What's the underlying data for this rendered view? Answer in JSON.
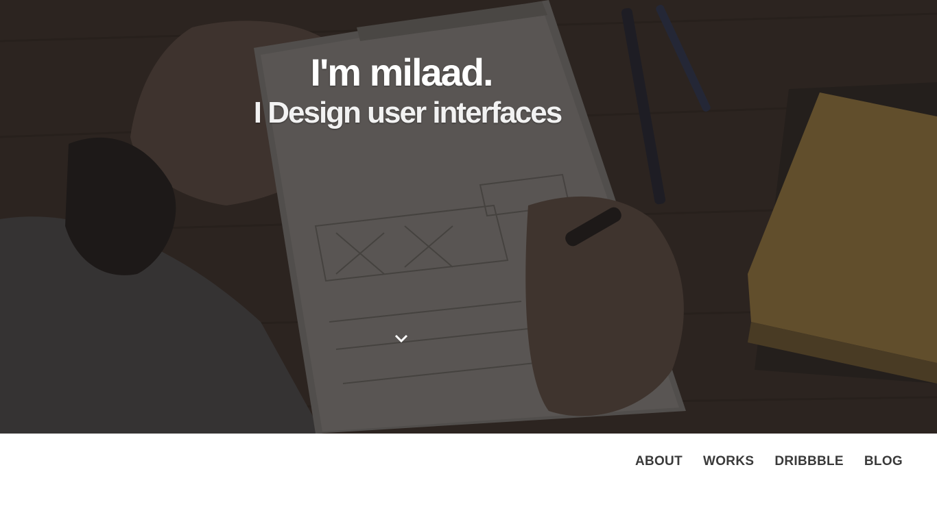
{
  "hero": {
    "title": "I'm milaad.",
    "subtitle": "I Design user interfaces",
    "scroll_icon": "chevron-down-icon"
  },
  "nav": {
    "items": [
      {
        "label": "ABOUT"
      },
      {
        "label": "WORKS"
      },
      {
        "label": "DRIBBBLE"
      },
      {
        "label": "BLOG"
      }
    ]
  },
  "colors": {
    "hero_overlay": "#2f2a27",
    "nav_text": "#3a3a3a",
    "notebook_accent": "#9a7a3e"
  }
}
